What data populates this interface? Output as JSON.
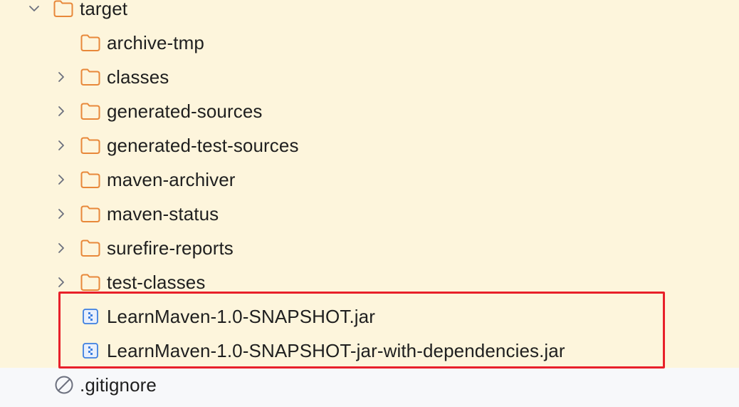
{
  "colors": {
    "highlight_bg": "#fdf5dc",
    "panel_bg": "#f7f8fa",
    "folder_stroke": "#e8883a",
    "jar_icon": "#3d7fe0",
    "selection_border": "#e8202a",
    "text": "#1f1f1f"
  },
  "tree": {
    "target": {
      "label": "target",
      "icon": "folder-icon",
      "expanded": true
    },
    "children": [
      {
        "label": "archive-tmp",
        "icon": "folder-icon",
        "expandable": false
      },
      {
        "label": "classes",
        "icon": "folder-icon",
        "expandable": true
      },
      {
        "label": "generated-sources",
        "icon": "folder-icon",
        "expandable": true
      },
      {
        "label": "generated-test-sources",
        "icon": "folder-icon",
        "expandable": true
      },
      {
        "label": "maven-archiver",
        "icon": "folder-icon",
        "expandable": true
      },
      {
        "label": "maven-status",
        "icon": "folder-icon",
        "expandable": true
      },
      {
        "label": "surefire-reports",
        "icon": "folder-icon",
        "expandable": true
      },
      {
        "label": "test-classes",
        "icon": "folder-icon",
        "expandable": true
      },
      {
        "label": "LearnMaven-1.0-SNAPSHOT.jar",
        "icon": "jar-file-icon",
        "expandable": false
      },
      {
        "label": "LearnMaven-1.0-SNAPSHOT-jar-with-dependencies.jar",
        "icon": "jar-file-icon",
        "expandable": false
      }
    ],
    "gitignore": {
      "label": ".gitignore",
      "icon": "ignored-file-icon"
    }
  }
}
